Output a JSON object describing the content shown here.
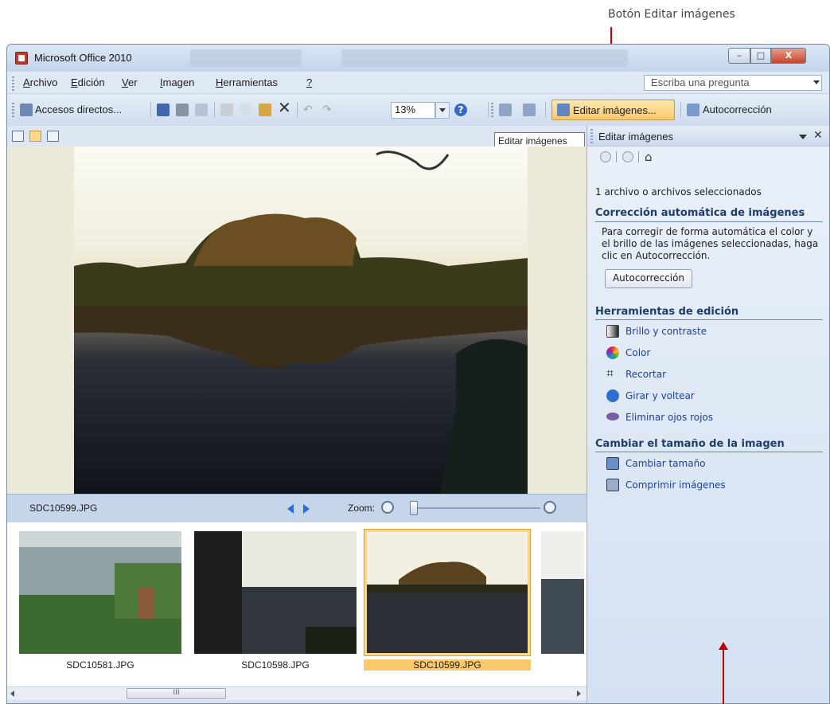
{
  "annotation": {
    "top_label": "Botón Editar imágenes"
  },
  "window": {
    "title": "Microsoft Office 2010",
    "controls": [
      "–",
      "□",
      "X"
    ]
  },
  "menu": {
    "items": [
      {
        "pre": "",
        "u": "A",
        "post": "rchivo"
      },
      {
        "pre": "",
        "u": "E",
        "post": "dición"
      },
      {
        "pre": "",
        "u": "V",
        "post": "er"
      },
      {
        "pre": "",
        "u": "I",
        "post": "magen"
      },
      {
        "pre": "",
        "u": "H",
        "post": "erramientas"
      },
      {
        "pre": "",
        "u": "?",
        "post": ""
      }
    ],
    "question_placeholder": "Escriba una pregunta"
  },
  "toolbar": {
    "shortcuts": "Accesos directos...",
    "zoom": "13%",
    "edit_images": "Editar imágenes...",
    "autocorrect": "Autocorrección"
  },
  "tooltip": "Editar imágenes",
  "preview": {
    "filename": "SDC10599.JPG",
    "zoom_label": "Zoom:"
  },
  "thumbnails": [
    {
      "name": "SDC10581.JPG",
      "selected": false
    },
    {
      "name": "SDC10598.JPG",
      "selected": false
    },
    {
      "name": "SDC10599.JPG",
      "selected": true
    }
  ],
  "scrollbar": {
    "grip": "III"
  },
  "pane": {
    "title": "Editar imágenes",
    "selected_count": "1 archivo o archivos seleccionados",
    "auto_heading": "Corrección automática de imágenes",
    "auto_desc": [
      "Para corregir de forma automática el color y",
      "el brillo de las imágenes seleccionadas, haga",
      "clic en Autocorrección."
    ],
    "auto_button": "Autocorrección",
    "tools_heading": "Herramientas de edición",
    "tools": [
      "Brillo y contraste",
      "Color",
      "Recortar",
      "Girar y voltear",
      "Eliminar ojos rojos"
    ],
    "resize_heading": "Cambiar el tamaño de la imagen",
    "resize": [
      "Cambiar tamaño",
      "Comprimir imágenes"
    ]
  },
  "colors": {
    "accent": "#c00000",
    "selection": "#fbd88e",
    "pane_bg": "#d3e1f2"
  }
}
